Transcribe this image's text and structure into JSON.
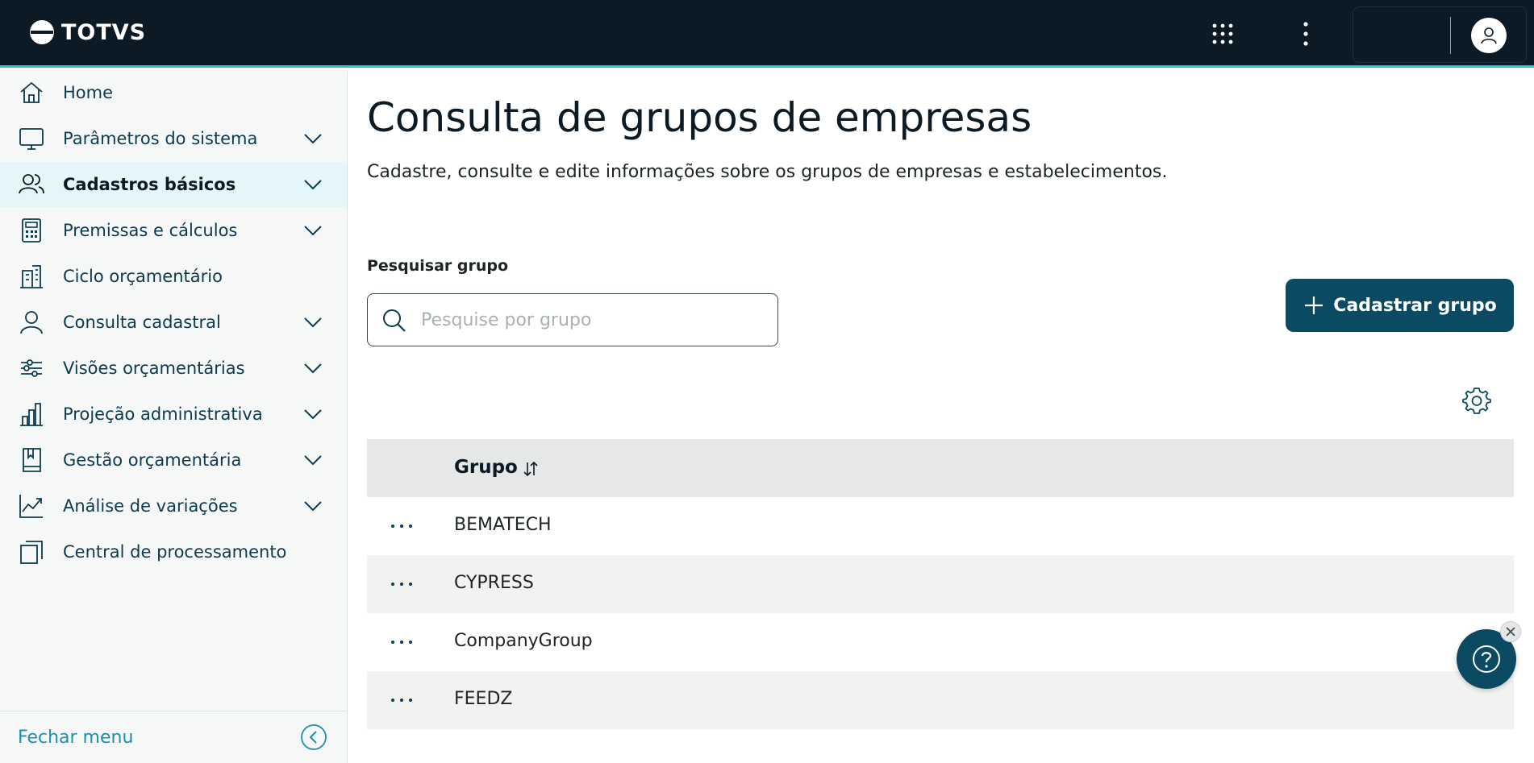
{
  "brand": {
    "name": "TOTVS"
  },
  "sidebar": {
    "items": [
      {
        "label": "Home",
        "icon": "home-icon",
        "expandable": false,
        "active": false
      },
      {
        "label": "Parâmetros do sistema",
        "icon": "monitor-icon",
        "expandable": true,
        "active": false
      },
      {
        "label": "Cadastros básicos",
        "icon": "users-icon",
        "expandable": true,
        "active": true
      },
      {
        "label": "Premissas e cálculos",
        "icon": "calculator-icon",
        "expandable": true,
        "active": false
      },
      {
        "label": "Ciclo orçamentário",
        "icon": "building-icon",
        "expandable": false,
        "active": false
      },
      {
        "label": "Consulta cadastral",
        "icon": "user-icon",
        "expandable": true,
        "active": false
      },
      {
        "label": "Visões orçamentárias",
        "icon": "sliders-icon",
        "expandable": true,
        "active": false
      },
      {
        "label": "Projeção administrativa",
        "icon": "bar-chart-icon",
        "expandable": true,
        "active": false
      },
      {
        "label": "Gestão orçamentária",
        "icon": "book-icon",
        "expandable": true,
        "active": false
      },
      {
        "label": "Análise de variações",
        "icon": "line-chart-icon",
        "expandable": true,
        "active": false
      },
      {
        "label": "Central de processamento",
        "icon": "copy-icon",
        "expandable": false,
        "active": false
      }
    ],
    "close_label": "Fechar menu"
  },
  "main": {
    "title": "Consulta de grupos de empresas",
    "description": "Cadastre, consulte e edite informações sobre os grupos de empresas e estabelecimentos.",
    "search": {
      "label": "Pesquisar grupo",
      "placeholder": "Pesquise por grupo",
      "value": ""
    },
    "add_button_label": "Cadastrar grupo",
    "table": {
      "column": "Grupo",
      "rows": [
        "BEMATECH",
        "CYPRESS",
        "CompanyGroup",
        "FEEDZ"
      ],
      "row_action_label": "···"
    }
  },
  "colors": {
    "topbar": "#0b1a24",
    "accent": "#0b4a62",
    "highlight": "#2ec1d6",
    "active_item": "#e4f6f9"
  }
}
